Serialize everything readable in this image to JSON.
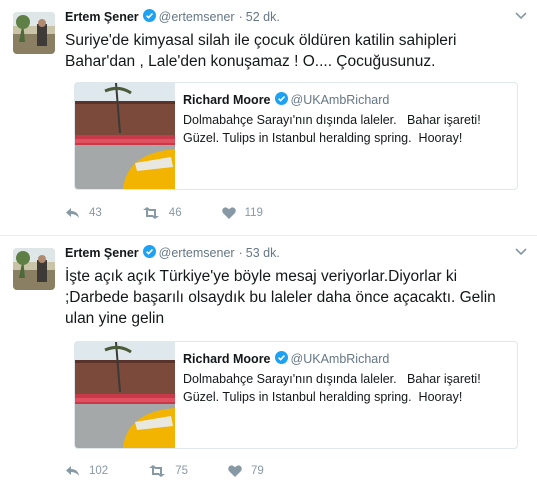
{
  "tweets": [
    {
      "author_name": "Ertem Şener",
      "handle": "@ertemsener",
      "separator": "·",
      "time": "52 dk.",
      "text_lines": [
        "Suriye'de kimyasal silah ile çocuk öldüren katilin sahipleri",
        "Bahar'dan , Lale'den konuşamaz ! O.... Çocuğusunuz."
      ],
      "quoted": {
        "author_name": "Richard Moore",
        "handle": "@UKAmbRichard",
        "text_lines": [
          "Dolmabahçe Sarayı'nın dışında laleler.   Bahar işareti!",
          "Güzel. Tulips in Istanbul heralding spring.  Hooray!"
        ]
      },
      "reply_count": "43",
      "retweet_count": "46",
      "like_count": "119"
    },
    {
      "author_name": "Ertem Şener",
      "handle": "@ertemsener",
      "separator": "·",
      "time": "53 dk.",
      "text_lines": [
        "İşte açık açık Türkiye'ye böyle mesaj veriyorlar.Diyorlar ki",
        ";Darbede başarılı olsaydık bu laleler daha önce açacaktı. Gelin",
        "ulan yine gelin"
      ],
      "quoted": {
        "author_name": "Richard Moore",
        "handle": "@UKAmbRichard",
        "text_lines": [
          "Dolmabahçe Sarayı'nın dışında laleler.   Bahar işareti!",
          "Güzel. Tulips in Istanbul heralding spring.  Hooray!"
        ]
      },
      "reply_count": "102",
      "retweet_count": "75",
      "like_count": "79"
    }
  ],
  "icons": {
    "verified": "verified-badge-icon",
    "caret": "chevron-down-icon",
    "reply": "reply-icon",
    "retweet": "retweet-icon",
    "like": "heart-icon"
  },
  "colors": {
    "verified": "#1da1f2",
    "action_gray": "#8899a6",
    "meta_gray": "#657786",
    "text": "#14171a",
    "divider": "#e6ecf0"
  }
}
